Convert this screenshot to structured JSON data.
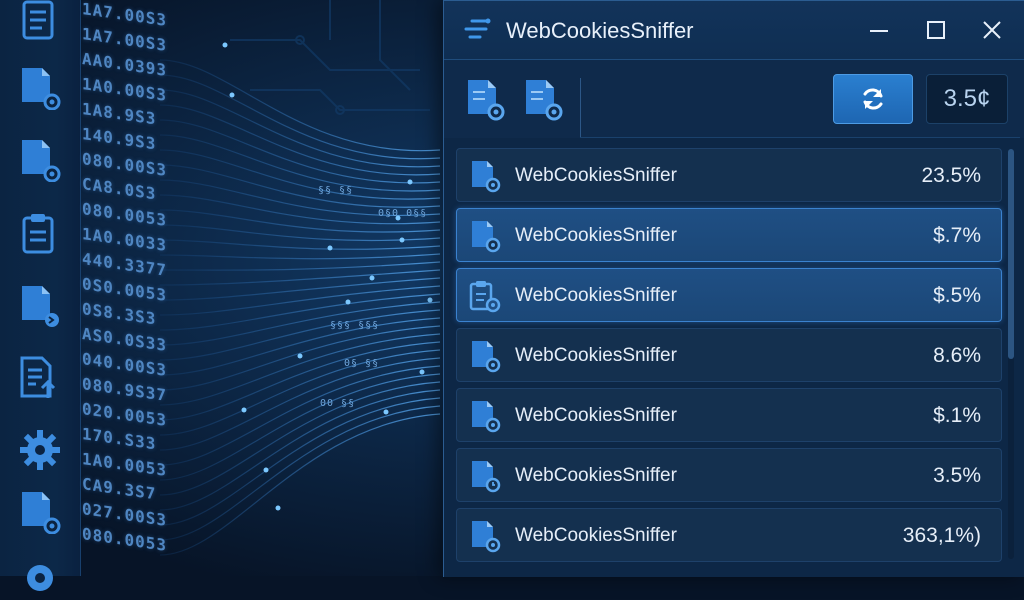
{
  "background": {
    "number_columns": [
      [
        "1A7.00S3",
        "1A7.00S3",
        "AA0.0393",
        "1A0.00S3",
        "1A8.9S3",
        "140.9S3",
        "080.00S3",
        "CA8.0S3",
        "080.0053",
        "1A0.0033",
        "440.3377",
        "0S0.0053",
        "0S8.3S3",
        "AS0.0S33",
        "040.00S3",
        "080.9S37",
        "020.0053",
        "170.S33",
        "1A0.0053",
        "CA9.3S7",
        "027.00S3",
        "080.0053"
      ]
    ],
    "side_icons": [
      "file-list-icon",
      "file-gear-icon",
      "file-gear-icon",
      "clipboard-icon",
      "file-arrow-icon",
      "file-upload-icon",
      "gear-icon",
      "file-gear-icon",
      "gear-icon"
    ],
    "stream_numbers": [
      "§§ §§",
      "0§0 0§§",
      "§§§ §§§",
      "00 §§",
      "0§ §§"
    ]
  },
  "window": {
    "title": "WebCookiesSniffer",
    "icon": "app-lines-icon",
    "controls": [
      "minimize-icon",
      "maximize-icon",
      "close-icon"
    ]
  },
  "toolbar": {
    "buttons": [
      "file-gear-icon",
      "file-gear-icon"
    ],
    "refresh_icon": "refresh-icon",
    "value": "3.5¢"
  },
  "list": {
    "rows": [
      {
        "name": "WebCookiesSniffer",
        "value": "23.5%",
        "icon": "file-gear-icon",
        "selected": false
      },
      {
        "name": "WebCookiesSniffer",
        "value": "$.7%",
        "icon": "file-gear-icon",
        "selected": true
      },
      {
        "name": "WebCookiesSniffer",
        "value": "$.5%",
        "icon": "clipboard-gear-icon",
        "selected": true
      },
      {
        "name": "WebCookiesSniffer",
        "value": "8.6%",
        "icon": "file-gear-icon",
        "selected": false
      },
      {
        "name": "WebCookiesSniffer",
        "value": "$.1%",
        "icon": "file-gear-icon",
        "selected": false
      },
      {
        "name": "WebCookiesSniffer",
        "value": "3.5%",
        "icon": "file-clock-icon",
        "selected": false
      },
      {
        "name": "WebCookiesSniffer",
        "value": "363,1%)",
        "icon": "file-gear-icon",
        "selected": false
      }
    ]
  },
  "colors": {
    "accent": "#2a7fd0",
    "window_bg": "#0d2746",
    "row_bg": "#14304f",
    "row_selected": "#1f4f84",
    "text": "#e6eef8"
  }
}
